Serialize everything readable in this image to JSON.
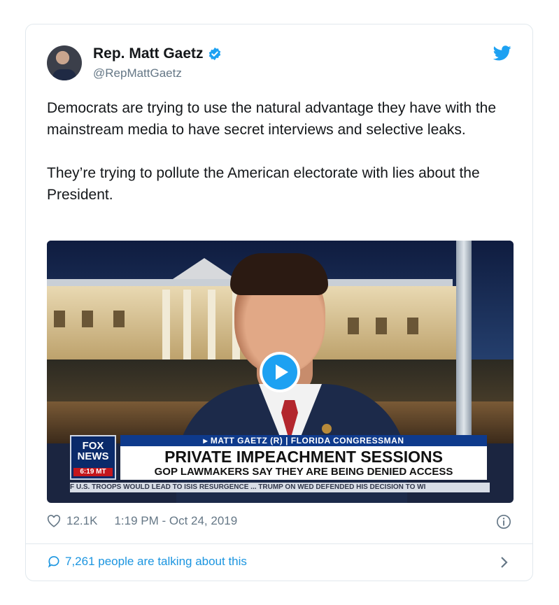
{
  "tweet": {
    "author_name": "Rep. Matt Gaetz",
    "handle": "@RepMattGaetz",
    "paragraphs": [
      "Democrats are trying to use the natural advantage they have with the mainstream media to have secret interviews and selective leaks.",
      "They’re trying to pollute the American electorate with lies about the President."
    ],
    "likes": "12.1K",
    "timestamp": "1:19 PM - Oct 24, 2019",
    "talking": "7,261 people are talking about this"
  },
  "video": {
    "network_line1": "FOX",
    "network_line2": "NEWS",
    "time_badge": "6:19 MT",
    "strap_top": "▸ MATT GAETZ (R) | FLORIDA CONGRESSMAN",
    "headline": "PRIVATE IMPEACHMENT SESSIONS",
    "subheadline": "GOP LAWMAKERS SAY THEY ARE BEING DENIED ACCESS",
    "ticker": "F U.S. TROOPS WOULD LEAD TO ISIS RESURGENCE ... TRUMP ON WED DEFENDED HIS DECISION TO WI"
  },
  "colors": {
    "accent": "#1da1f2",
    "link": "#1b95e0",
    "muted": "#657786",
    "border": "#e1e8ed"
  },
  "icons": [
    "verified-badge-icon",
    "twitter-bird-icon",
    "play-icon",
    "heart-icon",
    "info-icon",
    "comment-icon",
    "chevron-right-icon"
  ]
}
